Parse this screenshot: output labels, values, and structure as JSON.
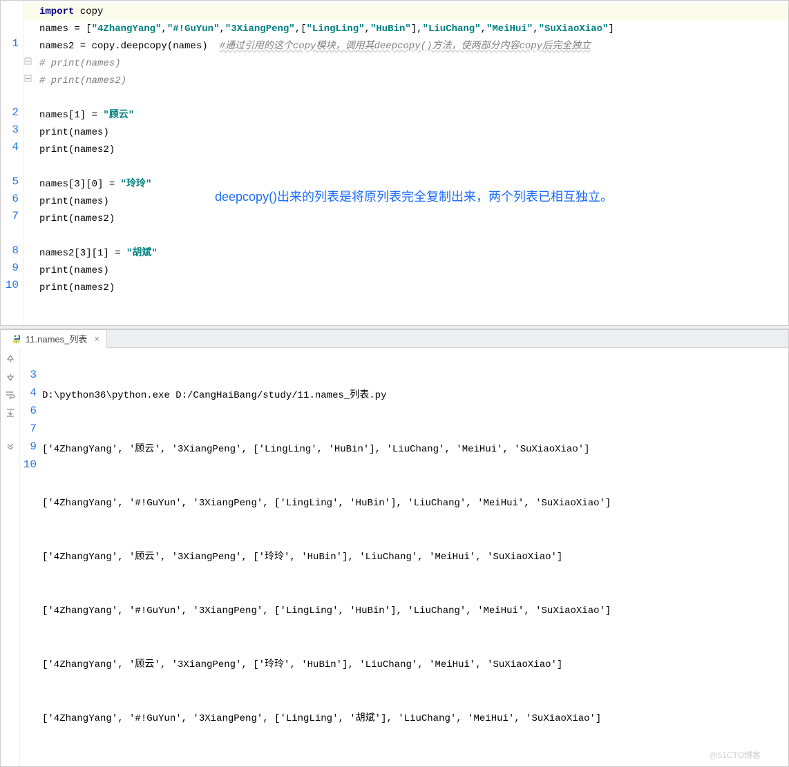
{
  "editor": {
    "gutter_numbers": {
      "n1": "1",
      "n2": "2",
      "n3": "3",
      "n4": "4",
      "n5": "5",
      "n6": "6",
      "n7": "7",
      "n8": "8",
      "n9": "9",
      "n10": "10"
    },
    "line1": {
      "kw": "import",
      "rest": " copy"
    },
    "line2": {
      "a": "names = [",
      "s1": "\"4ZhangYang\"",
      "c1": ",",
      "s2": "\"#!GuYun\"",
      "c2": ",",
      "s3": "\"3XiangPeng\"",
      "c3": ",[",
      "s4": "\"LingLing\"",
      "c4": ",",
      "s5": "\"HuBin\"",
      "c5": "],",
      "s6": "\"LiuChang\"",
      "c6": ",",
      "s7": "\"MeiHui\"",
      "c7": ",",
      "s8": "\"SuXiaoXiao\"",
      "c8": "]"
    },
    "line3": {
      "a": "names2 = copy.deepcopy(names)  ",
      "com": "#通过引用的这个copy模块，调用其deepcopy()方法，使两部分内容copy后完全独立"
    },
    "line4": {
      "com": "# print(names)"
    },
    "line5": {
      "com": "# print(names2)"
    },
    "line7": {
      "a": "names[1] = ",
      "s": "\"顾云\""
    },
    "line8": {
      "fn": "print",
      "rest": "(names)"
    },
    "line9": {
      "fn": "print",
      "rest": "(names2)"
    },
    "line11": {
      "a": "names[3][0] = ",
      "s": "\"玲玲\""
    },
    "line12": {
      "fn": "print",
      "rest": "(names)"
    },
    "line13": {
      "fn": "print",
      "rest": "(names2)"
    },
    "line15": {
      "a": "names2[3][1] = ",
      "s": "\"胡斌\""
    },
    "line16": {
      "fn": "print",
      "rest": "(names)"
    },
    "line17": {
      "fn": "print",
      "rest": "(names2)"
    },
    "annotation": "deepcopy()出来的列表是将原列表完全复制出来，两个列表已相互独立。"
  },
  "run_tab": {
    "label": "11.names_列表"
  },
  "console": {
    "cmd": "D:\\python36\\python.exe D:/CangHaiBang/study/11.names_列表.py",
    "gutter": {
      "g1": "3",
      "g2": "4",
      "g3": "6",
      "g4": "7",
      "g5": "9",
      "g6": "10"
    },
    "lines": {
      "l1": "['4ZhangYang', '顾云', '3XiangPeng', ['LingLing', 'HuBin'], 'LiuChang', 'MeiHui', 'SuXiaoXiao']",
      "l2": "['4ZhangYang', '#!GuYun', '3XiangPeng', ['LingLing', 'HuBin'], 'LiuChang', 'MeiHui', 'SuXiaoXiao']",
      "l3": "['4ZhangYang', '顾云', '3XiangPeng', ['玲玲', 'HuBin'], 'LiuChang', 'MeiHui', 'SuXiaoXiao']",
      "l4": "['4ZhangYang', '#!GuYun', '3XiangPeng', ['LingLing', 'HuBin'], 'LiuChang', 'MeiHui', 'SuXiaoXiao']",
      "l5": "['4ZhangYang', '顾云', '3XiangPeng', ['玲玲', 'HuBin'], 'LiuChang', 'MeiHui', 'SuXiaoXiao']",
      "l6": "['4ZhangYang', '#!GuYun', '3XiangPeng', ['LingLing', '胡斌'], 'LiuChang', 'MeiHui', 'SuXiaoXiao']"
    }
  },
  "watermark": "@51CTO博客"
}
